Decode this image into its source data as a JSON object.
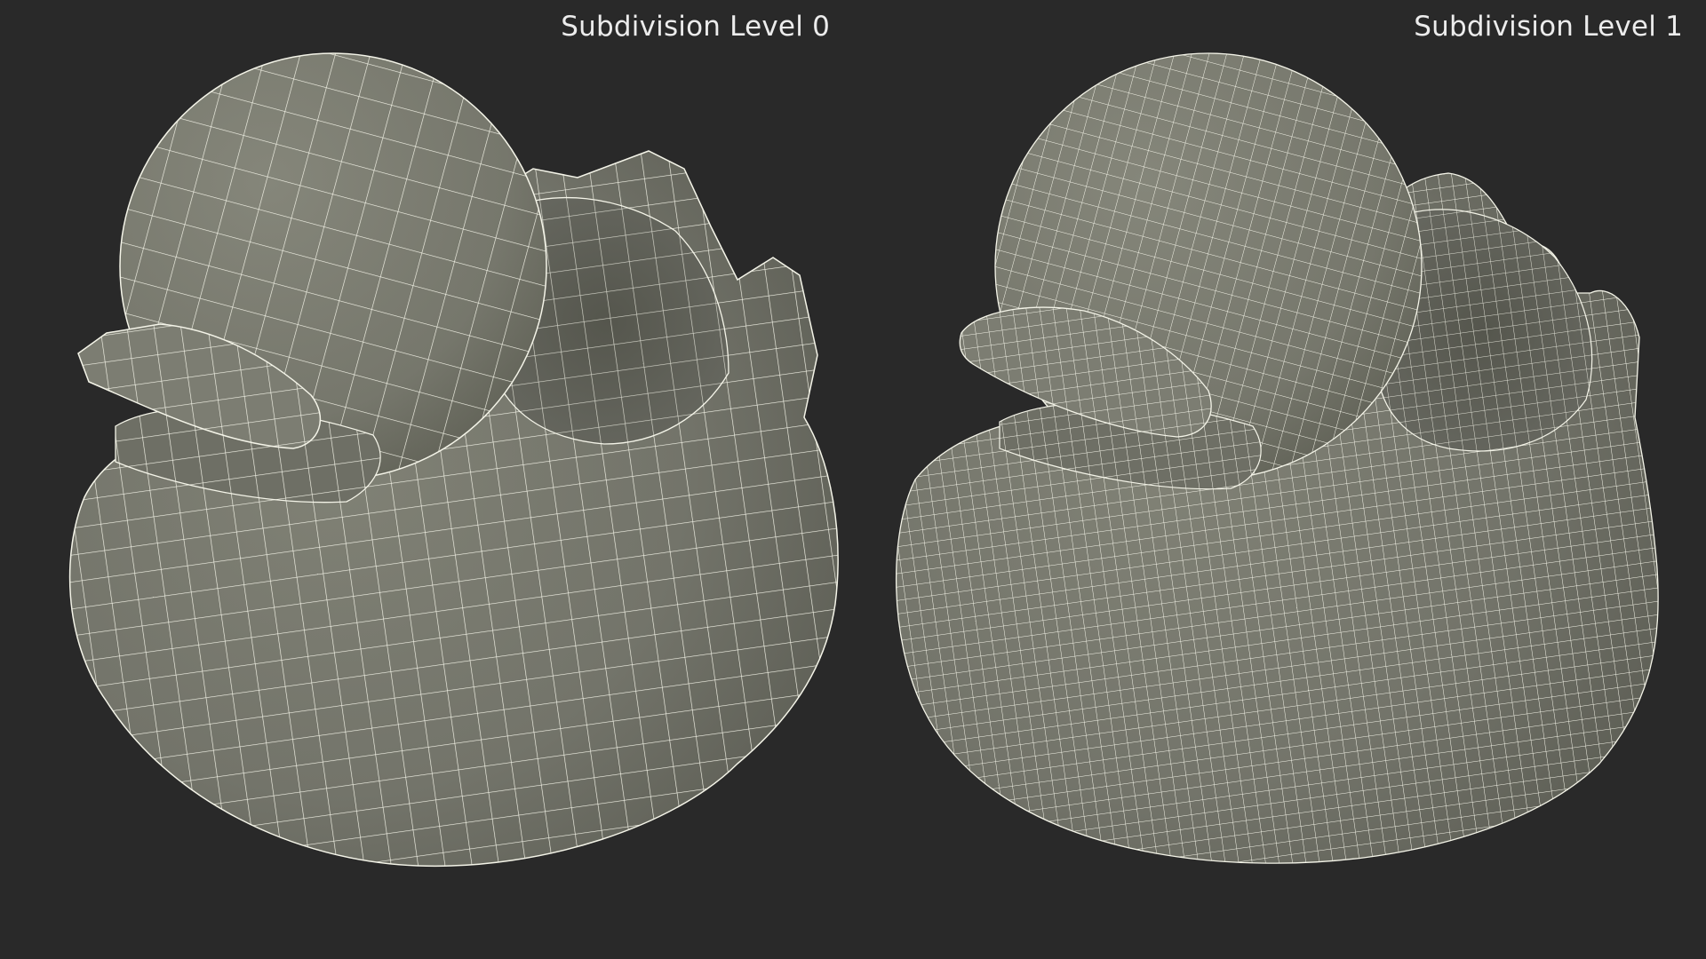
{
  "labels": {
    "level0": "Subdivision Level 0",
    "level1": "Subdivision Level 1"
  },
  "colors": {
    "background": "#292929",
    "surface": "#76776c",
    "surface_shadow": "#4c4d45",
    "wire": "#f4f4e8",
    "label": "#ececec"
  },
  "models": [
    {
      "name": "rubber-duck",
      "subdivision_level": 0,
      "wireframe": true
    },
    {
      "name": "rubber-duck",
      "subdivision_level": 1,
      "wireframe": true
    }
  ]
}
